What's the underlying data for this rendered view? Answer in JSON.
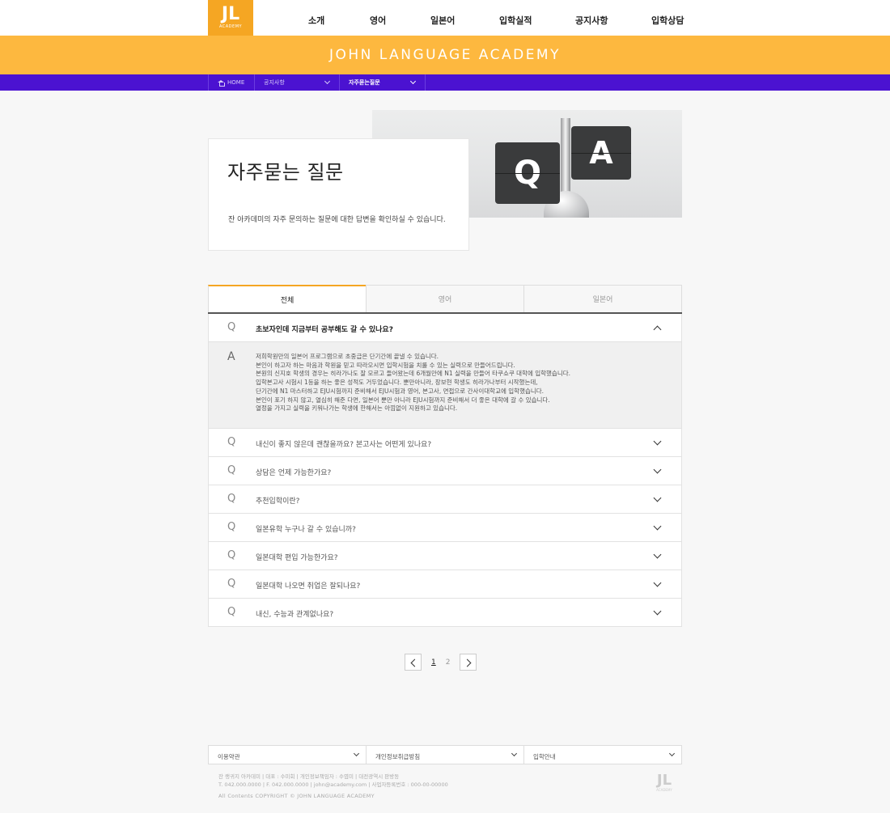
{
  "header": {
    "logo_mark": "JL",
    "logo_sub": "ACADEMY",
    "nav": [
      "소개",
      "영어",
      "일본어",
      "입학실적",
      "공지사항",
      "입학상담"
    ],
    "banner_title": "JOHN LANGUAGE ACADEMY"
  },
  "breadcrumb": {
    "home": "HOME",
    "level1": "공지사항",
    "level2": "자주묻는질문"
  },
  "hero": {
    "title": "자주묻는 질문",
    "description": "잔 아카데미의 자주 문의하는 질문에 대한 답변을 확인하실 수 있습니다.",
    "image_letters": [
      "Q",
      "A"
    ]
  },
  "tabs": {
    "items": [
      "전체",
      "영어",
      "일본어"
    ],
    "active": "전체"
  },
  "faq": {
    "q_marker": "Q",
    "a_marker": "A",
    "open_question": "초보자인데 지금부터 공부해도 갈 수 있나요?",
    "answer_lines": [
      "저희학원만의 일본어 프로그램으로 초중급은 단기간에 끝낼 수 있습니다.",
      "본인이 하고자 하는 마음과 학원을 믿고 따라오시면 입학시험을 치룰 수 있는 실력으로 만들어드립니다.",
      "본원의 신지호 학생의 경우는 히라가나도 잘 모르고 들어왔는데 6개월만에 N1 실력을 만들어 타쿠쇼쿠 대학에 입학했습니다.",
      "입학본고사 시험시 1등을 하는 좋은 성적도 거두었습니다. 뿐만아니라, 장보현 학생도 히라가나부터 시작했는데,",
      "단기간에 N1 마스터하고 EJU시험까지 준비해서 EJU시험과 영어, 본고사, 면접으로 간사이대학교에 입학했습니다.",
      "본인이 포기 하지 않고, 열심히 해준 다면, 일본어 뿐만 아니라 EJU시험까지 준비해서 더 좋은 대학에 갈 수 있습니다.",
      "열정을 가지고 실력을 키워나가는 학생에 한해서는 아낌없이 지원하고 있습니다."
    ],
    "questions": [
      "내신이 좋지 않은데 괜찮을까요? 본고사는 어떤게 있나요?",
      "상담은 언제 가능한가요?",
      "추천입학이란?",
      "일본유학 누구나 갈 수 있습니까?",
      "일본대학 편입 가능한가요?",
      "일본대학 나오면 취업은 잘되나요?",
      "내신, 수능과 관계없나요?"
    ]
  },
  "pagination": {
    "pages": [
      "1",
      "2"
    ],
    "current": "1"
  },
  "footer": {
    "selects": [
      "이용약관",
      "개인정보취급방침",
      "입학안내"
    ],
    "info_line1": "잔 랭귀지 아카데미  |  대표 : 수미회  |  개인정보책임자 : 수엽미  |  대전광역시 판방동",
    "info_line2": "T. 042.000.0000  |  F. 042.000.0000  |  john@academy.com  |  사업자등록번호 : 000-00-00000",
    "copyright": "All Contents COPYRIGHT © JOHN LANGUAGE ACADEMY",
    "logo_mark": "JL",
    "logo_sub": "ACADEMY"
  },
  "colors": {
    "brand_orange": "#fdb83f",
    "nav_purple": "#4b12d1"
  }
}
